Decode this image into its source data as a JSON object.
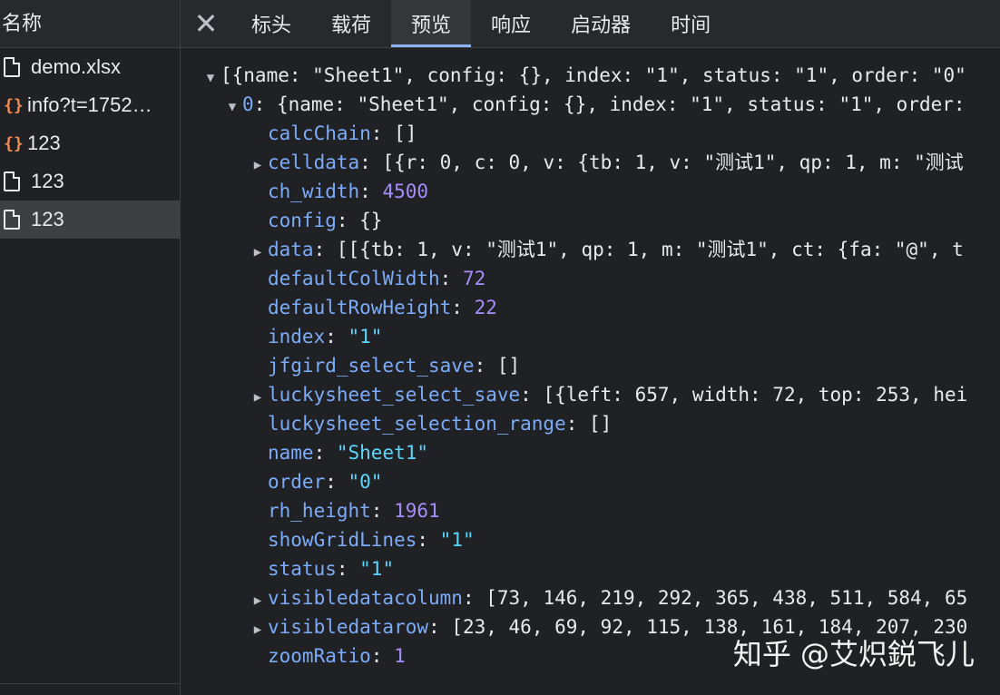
{
  "left_panel": {
    "header": "名称",
    "files": [
      {
        "type": "doc",
        "name": "demo.xlsx"
      },
      {
        "type": "json",
        "name": "info?t=1752…"
      },
      {
        "type": "json",
        "name": "123"
      },
      {
        "type": "doc",
        "name": "123"
      },
      {
        "type": "doc",
        "name": "123",
        "selected": true
      }
    ]
  },
  "tabs": {
    "close_glyph": "✕",
    "items": [
      "标头",
      "载荷",
      "预览",
      "响应",
      "启动器",
      "时间"
    ],
    "active": "预览"
  },
  "preview": {
    "root_summary": "[{name: \"Sheet1\", config: {}, index: \"1\", status: \"1\", order: \"0\"",
    "item0_key": "0",
    "item0_summary": "{name: \"Sheet1\", config: {}, index: \"1\", status: \"1\", order:",
    "props": [
      {
        "key": "calcChain",
        "value": "[]",
        "vtype": "p",
        "expandable": false
      },
      {
        "key": "celldata",
        "value": "[{r: 0, c: 0, v: {tb: 1, v: \"测试1\", qp: 1, m: \"测试",
        "vtype": "p",
        "expandable": true
      },
      {
        "key": "ch_width",
        "value": "4500",
        "vtype": "n",
        "expandable": false
      },
      {
        "key": "config",
        "value": "{}",
        "vtype": "p",
        "expandable": false
      },
      {
        "key": "data",
        "value": "[[{tb: 1, v: \"测试1\", qp: 1, m: \"测试1\", ct: {fa: \"@\", t",
        "vtype": "p",
        "expandable": true
      },
      {
        "key": "defaultColWidth",
        "value": "72",
        "vtype": "n",
        "expandable": false
      },
      {
        "key": "defaultRowHeight",
        "value": "22",
        "vtype": "n",
        "expandable": false
      },
      {
        "key": "index",
        "value": "\"1\"",
        "vtype": "s",
        "expandable": false
      },
      {
        "key": "jfgird_select_save",
        "value": "[]",
        "vtype": "p",
        "expandable": false
      },
      {
        "key": "luckysheet_select_save",
        "value": "[{left: 657, width: 72, top: 253, hei",
        "vtype": "p",
        "expandable": true
      },
      {
        "key": "luckysheet_selection_range",
        "value": "[]",
        "vtype": "p",
        "expandable": false
      },
      {
        "key": "name",
        "value": "\"Sheet1\"",
        "vtype": "s",
        "expandable": false
      },
      {
        "key": "order",
        "value": "\"0\"",
        "vtype": "s",
        "expandable": false
      },
      {
        "key": "rh_height",
        "value": "1961",
        "vtype": "n",
        "expandable": false
      },
      {
        "key": "showGridLines",
        "value": "\"1\"",
        "vtype": "s",
        "expandable": false
      },
      {
        "key": "status",
        "value": "\"1\"",
        "vtype": "s",
        "expandable": false
      },
      {
        "key": "visibledatacolumn",
        "value": "[73, 146, 219, 292, 365, 438, 511, 584, 65",
        "vtype": "p",
        "expandable": true
      },
      {
        "key": "visibledatarow",
        "value": "[23, 46, 69, 92, 115, 138, 161, 184, 207, 230",
        "vtype": "p",
        "expandable": true
      },
      {
        "key": "zoomRatio",
        "value": "1",
        "vtype": "n",
        "expandable": false
      }
    ]
  },
  "watermark": "知乎 @艾炽鋭飞儿",
  "colors": {
    "key": "#7cacf8",
    "number": "#a58dfa",
    "string": "#5cd5fb",
    "json_icon": "#f28b54",
    "tab_underline": "#8ab4f8"
  }
}
